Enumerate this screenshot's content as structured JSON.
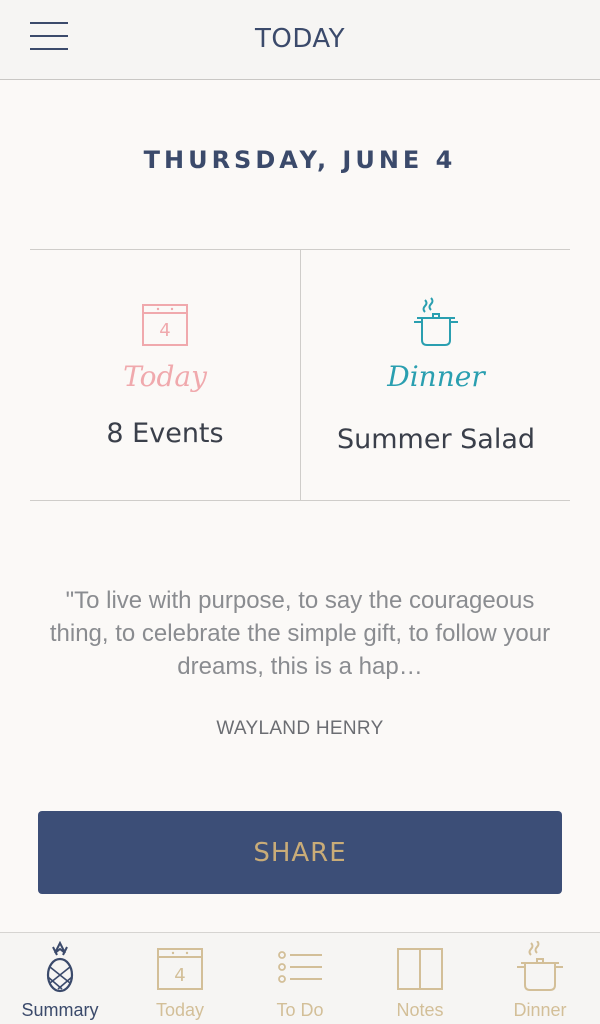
{
  "header": {
    "title": "TODAY",
    "menu_icon": "hamburger-menu-icon"
  },
  "date": "THURSDAY, JUNE 4",
  "cards": {
    "today": {
      "label": "Today",
      "value": "8 Events",
      "icon": "calendar-icon",
      "day": "4",
      "color": "#f0a9ad"
    },
    "dinner": {
      "label": "Dinner",
      "value": "Summer Salad",
      "icon": "cooking-pot-icon",
      "color": "#2a9fb0"
    }
  },
  "quote": {
    "text": "\"To live with purpose, to say the courageous thing, to celebrate the simple gift, to follow your dreams, this is a hap…",
    "author": "WAYLAND HENRY"
  },
  "share_label": "SHARE",
  "tabs": [
    {
      "label": "Summary",
      "icon": "pineapple-icon",
      "active": true
    },
    {
      "label": "Today",
      "icon": "calendar-icon",
      "day": "4"
    },
    {
      "label": "To Do",
      "icon": "checklist-icon"
    },
    {
      "label": "Notes",
      "icon": "notebook-icon"
    },
    {
      "label": "Dinner",
      "icon": "cooking-pot-icon"
    }
  ],
  "colors": {
    "navy": "#3b4a6b",
    "gold": "#c9ac78",
    "pink": "#f0a9ad",
    "teal": "#2a9fb0"
  }
}
